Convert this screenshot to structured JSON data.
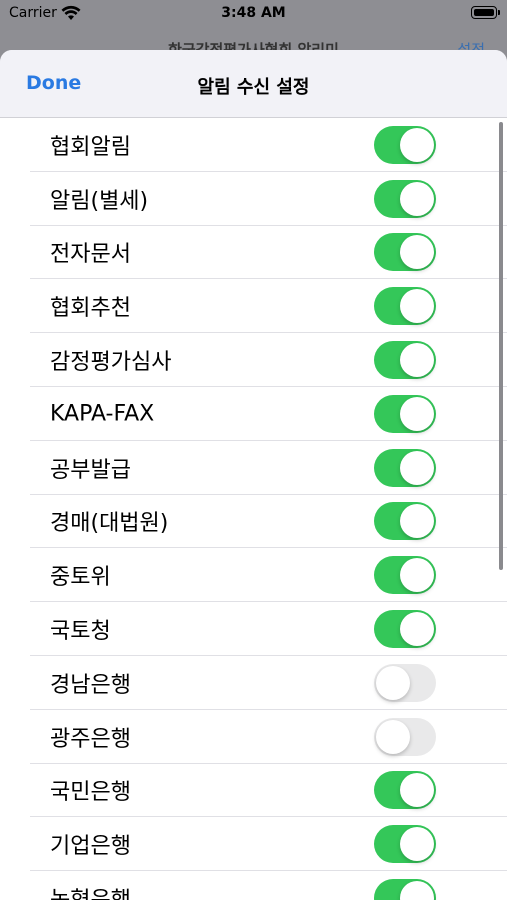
{
  "status": {
    "carrier": "Carrier",
    "time": "3:48 AM"
  },
  "background": {
    "title": "한국감정평가사협회 알리미",
    "action": "설정"
  },
  "nav": {
    "done_label": "Done",
    "title": "알림 수신 설정"
  },
  "settings": [
    {
      "label": "협회알림",
      "on": true
    },
    {
      "label": "알림(별세)",
      "on": true
    },
    {
      "label": "전자문서",
      "on": true
    },
    {
      "label": "협회추천",
      "on": true
    },
    {
      "label": "감정평가심사",
      "on": true
    },
    {
      "label": "KAPA-FAX",
      "on": true
    },
    {
      "label": "공부발급",
      "on": true
    },
    {
      "label": "경매(대법원)",
      "on": true
    },
    {
      "label": "중토위",
      "on": true
    },
    {
      "label": "국토청",
      "on": true
    },
    {
      "label": "경남은행",
      "on": false
    },
    {
      "label": "광주은행",
      "on": false
    },
    {
      "label": "국민은행",
      "on": true
    },
    {
      "label": "기업은행",
      "on": true
    },
    {
      "label": "농협은행",
      "on": true
    }
  ],
  "colors": {
    "accent": "#2a7ae2",
    "switch_on": "#34c759",
    "switch_off": "#e9e9ea"
  }
}
